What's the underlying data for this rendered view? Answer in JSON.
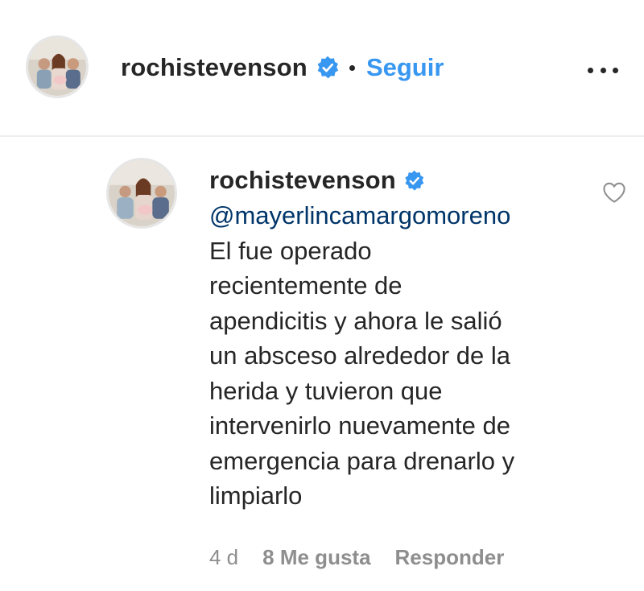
{
  "header": {
    "username": "rochistevenson",
    "verified_icon": "verified-badge-icon",
    "follow_label": "Seguir",
    "more_icon": "more-options-icon"
  },
  "comment": {
    "username": "rochistevenson",
    "verified_icon": "verified-badge-icon",
    "mention": "@mayerlincamargomoreno",
    "text_lines": [
      "El fue operado",
      "recientemente de",
      "apendicitis y ahora le salió",
      "un absceso alrededor de la",
      "herida y tuvieron que",
      "intervenirlo nuevamente de",
      "emergencia para drenarlo y",
      "limpiarlo"
    ],
    "like_icon": "heart-outline-icon",
    "time": "4 d",
    "likes": "8 Me gusta",
    "reply_label": "Responder"
  },
  "colors": {
    "accent": "#3897f0",
    "mention": "#003569",
    "text": "#262626",
    "meta": "#8e8e8e",
    "divider": "#efefef"
  }
}
